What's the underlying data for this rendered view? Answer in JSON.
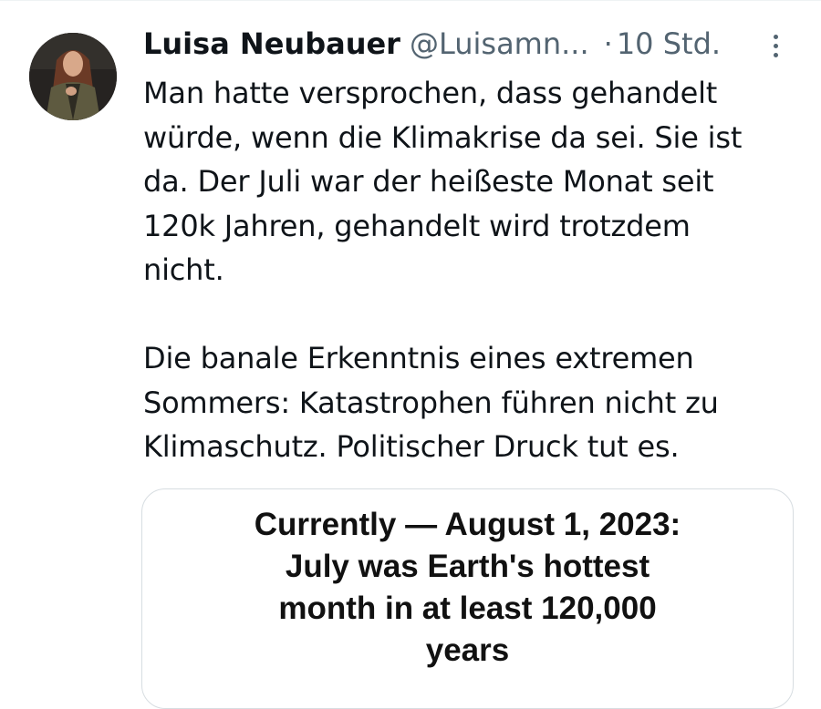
{
  "tweet": {
    "author": {
      "display_name": "Luisa Neubauer",
      "handle": "@Luisamn...",
      "avatar_icon": "profile-photo"
    },
    "separator": "·",
    "timestamp": "10 Std.",
    "more_icon": "more-vertical-icon",
    "text": {
      "paragraph1": [
        "Man hatte versprochen, dass gehandelt",
        "würde, wenn die Klimakrise da sei. Sie ist",
        "da. Der Juli war der heißeste Monat seit",
        "120k Jahren, gehandelt wird trotzdem",
        "nicht."
      ],
      "paragraph2": [
        "Die banale Erkenntnis eines extremen",
        "Sommers: Katastrophen führen nicht zu",
        "Klimaschutz. Politischer Druck tut es."
      ]
    },
    "media": {
      "lines": [
        "Currently — August 1, 2023:",
        "July was Earth's hottest",
        "month in at least 120,000",
        "years"
      ]
    }
  },
  "colors": {
    "text_primary": "#0f1419",
    "text_secondary": "#536471",
    "border": "#d7dde1"
  }
}
